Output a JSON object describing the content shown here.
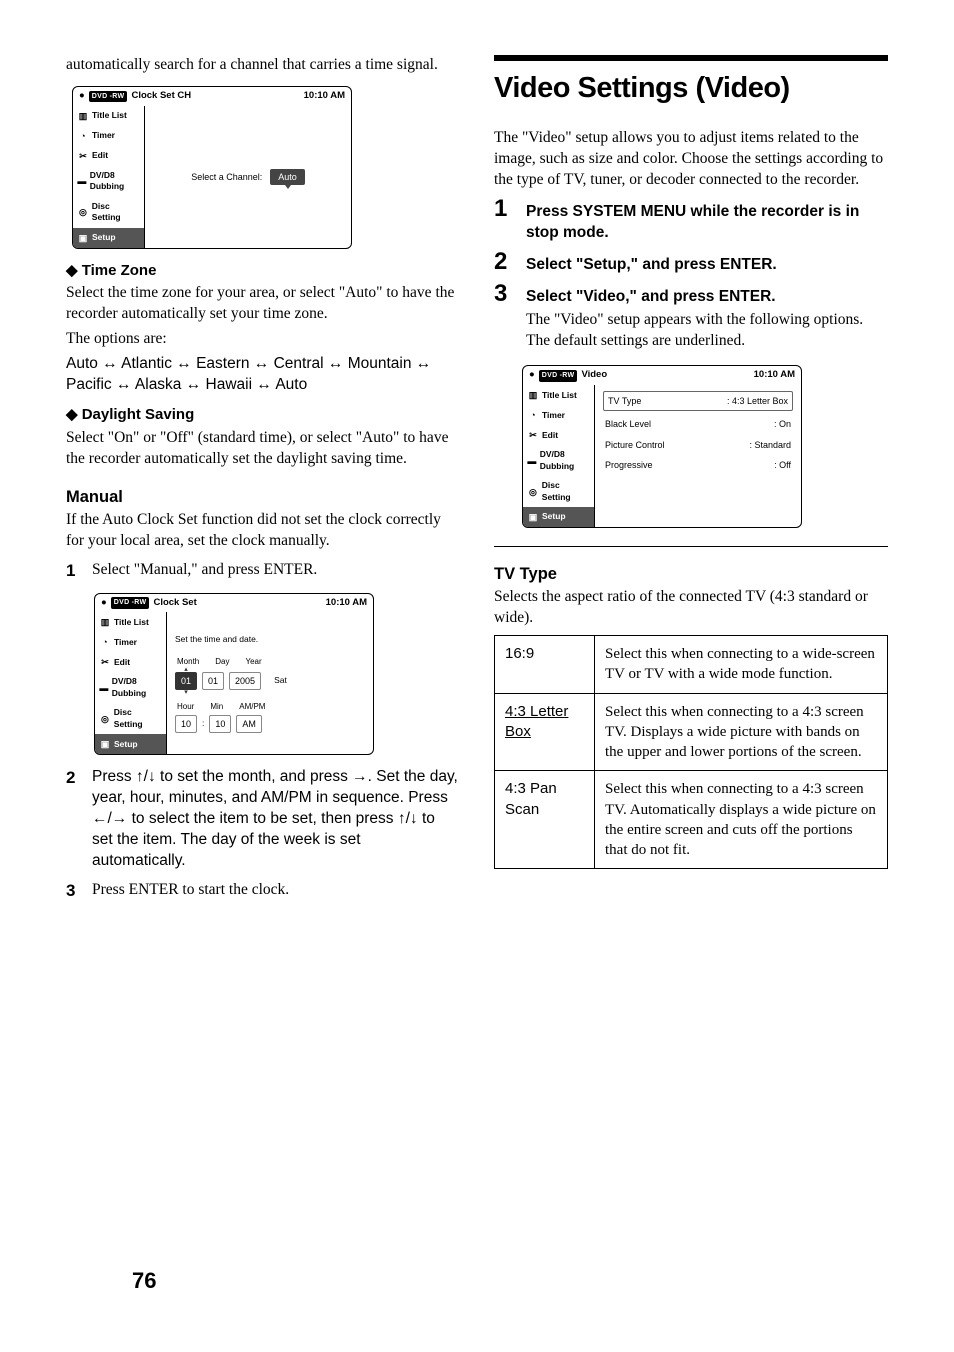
{
  "left": {
    "intro": "automatically search for a channel that carries a time signal.",
    "panel1": {
      "title": "Clock Set CH",
      "time": "10:10 AM",
      "sidebar": [
        "Title List",
        "Timer",
        "Edit",
        "DV/D8 Dubbing",
        "Disc Setting",
        "Setup"
      ],
      "main_label": "Select a Channel:",
      "main_value": "Auto"
    },
    "tz_head": "Time Zone",
    "tz_body1": "Select the time zone for your area, or select \"Auto\" to have the recorder automatically set your time zone.",
    "tz_body2": "The options are:",
    "tz_body3": "Auto ↔ Atlantic ↔ Eastern ↔ Central ↔ Mountain ↔ Pacific ↔ Alaska ↔ Hawaii ↔ Auto",
    "ds_head": "Daylight Saving",
    "ds_body": "Select \"On\" or \"Off\" (standard time), or select \"Auto\" to have the recorder automatically set the daylight saving time.",
    "manual_head": "Manual",
    "manual_intro": "If the Auto Clock Set function did not set the clock correctly for your local area, set the clock manually.",
    "step1": "Select \"Manual,\" and press ENTER.",
    "panel2": {
      "title": "Clock Set",
      "time": "10:10 AM",
      "sidebar": [
        "Title List",
        "Timer",
        "Edit",
        "DV/D8 Dubbing",
        "Disc Setting",
        "Setup"
      ],
      "line1": "Set the time and date.",
      "labels1": [
        "Month",
        "Day",
        "Year"
      ],
      "row1": [
        "01",
        "01",
        "2005",
        "Sat"
      ],
      "labels2": [
        "Hour",
        "Min",
        "AM/PM"
      ],
      "row2": [
        "10",
        "10",
        "AM"
      ]
    },
    "step2": "Press ↑/↓ to set the month, and press →. Set the day, year, hour, minutes, and AM/PM in sequence. Press ←/→ to select the item to be set, then press ↑/↓ to set the item. The day of the week is set automatically.",
    "step3": "Press ENTER to start the clock."
  },
  "right": {
    "title": "Video Settings (Video)",
    "intro": "The \"Video\" setup allows you to adjust items related to the image, such as size and color. Choose the settings according to the type of TV, tuner, or decoder connected to the recorder.",
    "steps": [
      "Press SYSTEM MENU while the recorder is in stop mode.",
      "Select \"Setup,\" and press ENTER.",
      "Select \"Video,\" and press ENTER."
    ],
    "step3_followup": "The \"Video\" setup appears with the following options. The default settings are underlined.",
    "panel": {
      "title": "Video",
      "time": "10:10 AM",
      "sidebar": [
        "Title List",
        "Timer",
        "Edit",
        "DV/D8 Dubbing",
        "Disc Setting",
        "Setup"
      ],
      "rows": [
        {
          "k": "TV Type",
          "v": ": 4:3 Letter Box"
        },
        {
          "k": "Black Level",
          "v": ": On"
        },
        {
          "k": "Picture Control",
          "v": ": Standard"
        },
        {
          "k": "Progressive",
          "v": ": Off"
        }
      ]
    },
    "tvtype_head": "TV Type",
    "tvtype_intro": "Selects the aspect ratio of the connected TV (4:3 standard or wide).",
    "table": [
      {
        "label": "16:9",
        "desc": "Select this when connecting to a wide-screen TV or TV with a wide mode function."
      },
      {
        "label": "4:3 Letter Box",
        "desc": "Select this when connecting to a 4:3 screen TV. Displays a wide picture with bands on the upper and lower portions of the screen.",
        "u": true
      },
      {
        "label": "4:3 Pan Scan",
        "desc": "Select this when connecting to a 4:3 screen TV. Automatically displays a wide picture on the entire screen and cuts off the portions that do not fit."
      }
    ]
  },
  "page_num": "76"
}
